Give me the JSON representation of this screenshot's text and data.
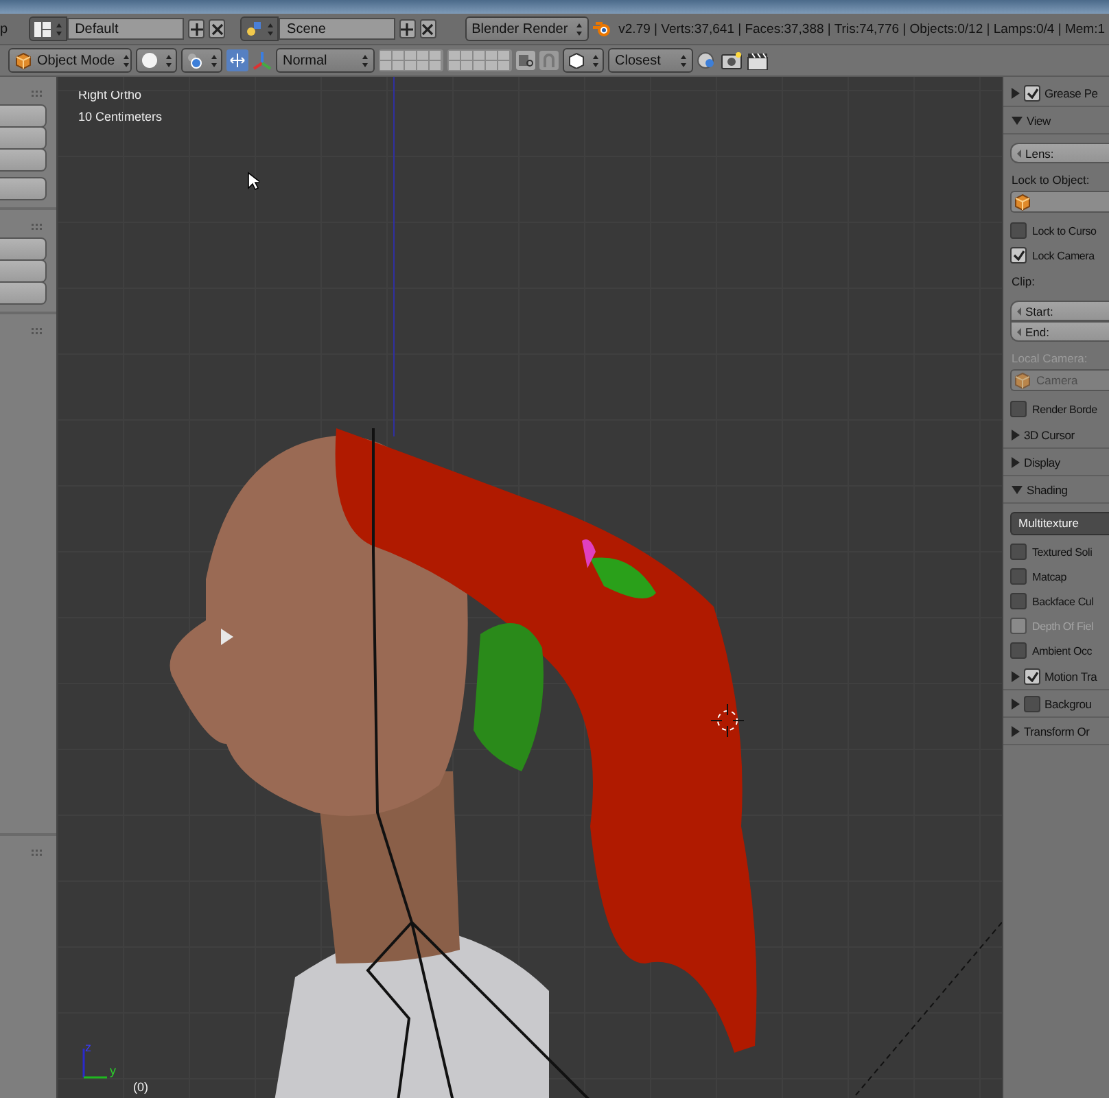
{
  "info_header": {
    "menu_partial": "p",
    "layout": "Default",
    "scene": "Scene",
    "engine": "Blender Render",
    "stats": "v2.79 | Verts:37,641 | Faces:37,388 | Tris:74,776 | Objects:0/12 | Lamps:0/4 | Mem:1"
  },
  "view_header": {
    "mode": "Object Mode",
    "orientation": "Normal",
    "snap_target": "Closest"
  },
  "viewport": {
    "view_name": "Right Ortho",
    "scale": "10 Centimeters",
    "frame": "(0)",
    "axis_z": "z",
    "axis_y": "y"
  },
  "properties": [
    {
      "kind": "panel_check",
      "label": "Grease Pe",
      "expanded": false,
      "checked": true
    },
    {
      "kind": "panel",
      "label": "View",
      "expanded": true
    },
    {
      "kind": "field",
      "label": "Lens:"
    },
    {
      "kind": "label",
      "label": "Lock to Object:",
      "disabled": false
    },
    {
      "kind": "object_field",
      "disabled": false
    },
    {
      "kind": "checkbox",
      "label": "Lock to Curso",
      "checked": false,
      "disabled": false
    },
    {
      "kind": "checkbox",
      "label": "Lock Camera",
      "checked": true,
      "disabled": false
    },
    {
      "kind": "label",
      "label": "Clip:",
      "disabled": false
    },
    {
      "kind": "field",
      "label": "Start:"
    },
    {
      "kind": "field",
      "label": "End:"
    },
    {
      "kind": "label",
      "label": "Local Camera:",
      "disabled": true
    },
    {
      "kind": "object_field",
      "label": "Camera",
      "disabled": true
    },
    {
      "kind": "checkbox",
      "label": "Render Borde",
      "checked": false,
      "disabled": false
    },
    {
      "kind": "panel",
      "label": "3D Cursor",
      "expanded": false
    },
    {
      "kind": "panel",
      "label": "Display",
      "expanded": false
    },
    {
      "kind": "panel",
      "label": "Shading",
      "expanded": true
    },
    {
      "kind": "select",
      "label": "Multitexture"
    },
    {
      "kind": "checkbox",
      "label": "Textured Soli",
      "checked": false,
      "disabled": false
    },
    {
      "kind": "checkbox",
      "label": "Matcap",
      "checked": false,
      "disabled": false
    },
    {
      "kind": "checkbox",
      "label": "Backface Cul",
      "checked": false,
      "disabled": false
    },
    {
      "kind": "checkbox",
      "label": "Depth Of Fiel",
      "checked": false,
      "disabled": true
    },
    {
      "kind": "checkbox",
      "label": "Ambient Occ",
      "checked": false,
      "disabled": false
    },
    {
      "kind": "panel_check",
      "label": "Motion Tra",
      "expanded": false,
      "checked": true
    },
    {
      "kind": "panel_check",
      "label": "Backgrou",
      "expanded": false,
      "checked": false
    },
    {
      "kind": "panel",
      "label": "Transform Or",
      "expanded": false
    }
  ]
}
